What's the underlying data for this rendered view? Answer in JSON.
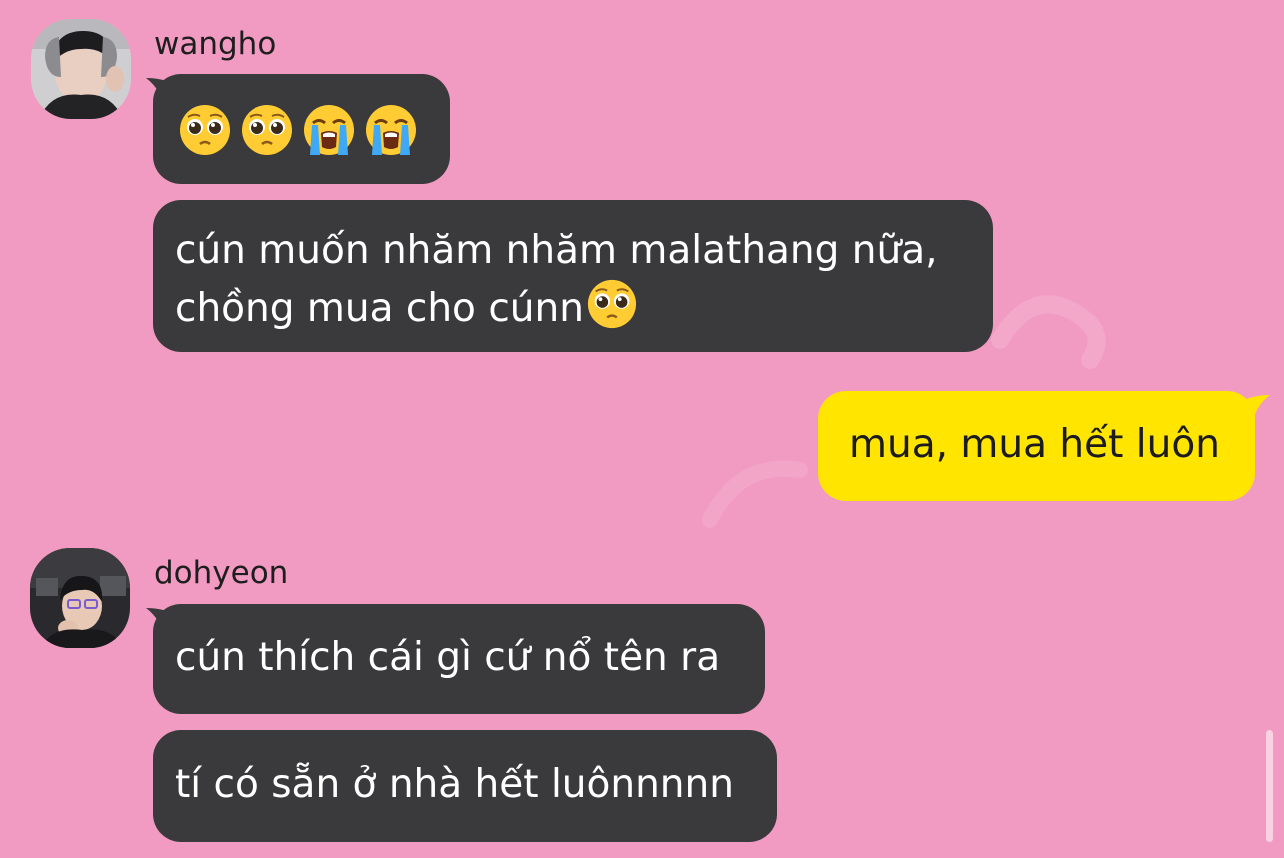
{
  "colors": {
    "background": "#f29bc2",
    "incoming_bubble": "#3a3a3c",
    "outgoing_bubble": "#ffe500",
    "incoming_text": "#ffffff",
    "outgoing_text": "#1c1c1c"
  },
  "messages": [
    {
      "sender": "wangho",
      "direction": "incoming",
      "avatar_icon": "user-avatar-photo",
      "bubbles": [
        {
          "type": "emoji",
          "emojis": [
            "pleading-face-icon",
            "pleading-face-icon",
            "loudly-crying-face-icon",
            "loudly-crying-face-icon"
          ]
        },
        {
          "type": "text",
          "lines": [
            "cún muốn nhăm nhăm malathang nữa,",
            "chồng mua cho cúnn"
          ],
          "trailing_emoji": "pleading-face-icon"
        }
      ]
    },
    {
      "sender": "me",
      "direction": "outgoing",
      "bubbles": [
        {
          "type": "text",
          "text": "mua, mua hết luôn"
        }
      ]
    },
    {
      "sender": "dohyeon",
      "direction": "incoming",
      "avatar_icon": "user-avatar-photo",
      "bubbles": [
        {
          "type": "text",
          "text": "cún thích cái gì cứ nổ tên ra"
        },
        {
          "type": "text",
          "text": "tí có sẵn ở nhà hết luônnnnn"
        }
      ]
    }
  ]
}
